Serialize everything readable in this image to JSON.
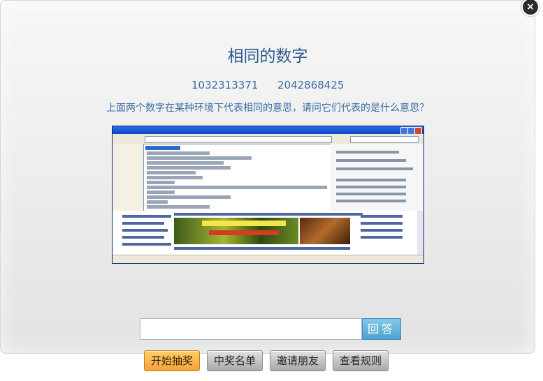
{
  "close_label": "×",
  "title": "相同的数字",
  "numbers": [
    "1032313371",
    "2042868425"
  ],
  "question": "上面两个数字在某种环境下代表相同的意思，请问它们代表的是什么意思？",
  "answer": {
    "value": "",
    "placeholder": "",
    "submit_label": "回答"
  },
  "buttons": {
    "lottery": "开始抽奖",
    "winners": "中奖名单",
    "invite": "邀请朋友",
    "rules": "查看规则"
  },
  "colors": {
    "title": "#2f5a8d",
    "text": "#3b6ea5",
    "lottery_button": "#f4a23a",
    "answer_button": "#4aa3cf"
  }
}
